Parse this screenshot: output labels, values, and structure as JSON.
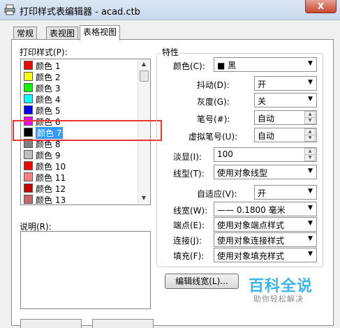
{
  "window": {
    "title": "打印样式表编辑器 - acad.ctb",
    "close": "X"
  },
  "tabs": [
    "常规",
    "表视图",
    "表格视图"
  ],
  "styles": {
    "label": "打印样式(P):",
    "items": [
      {
        "label": "颜色 1",
        "color": "#ff0000"
      },
      {
        "label": "颜色 2",
        "color": "#ffff00"
      },
      {
        "label": "颜色 3",
        "color": "#00ff00"
      },
      {
        "label": "颜色 4",
        "color": "#00ffff"
      },
      {
        "label": "颜色 5",
        "color": "#0000ff"
      },
      {
        "label": "颜色 6",
        "color": "#ff00ff"
      },
      {
        "label": "颜色 7",
        "color": "#000000"
      },
      {
        "label": "颜色 8",
        "color": "#808080"
      },
      {
        "label": "颜色 9",
        "color": "#c0c0c0"
      },
      {
        "label": "颜色 10",
        "color": "#ff0000"
      },
      {
        "label": "颜色 11",
        "color": "#ff7f7f"
      },
      {
        "label": "颜色 12",
        "color": "#cc0000"
      },
      {
        "label": "颜色 13",
        "color": "#cc6666"
      }
    ],
    "selected_index": 6
  },
  "description": {
    "label": "说明(R):"
  },
  "properties": {
    "group_title": "特性",
    "color": {
      "label": "颜色(C):",
      "value": "■ 黑"
    },
    "dither": {
      "label": "抖动(D):",
      "value": "开"
    },
    "grayscale": {
      "label": "灰度(G):",
      "value": "关"
    },
    "pen": {
      "label": "笔号(#):",
      "value": "自动"
    },
    "virtual_pen": {
      "label": "虚拟笔号(U):",
      "value": "自动"
    },
    "screening": {
      "label": "淡显(I):",
      "value": "100"
    },
    "linetype": {
      "label": "线型(T):",
      "value": "使用对象线型"
    },
    "adaptive": {
      "label": "自适应(V):",
      "value": "开"
    },
    "lineweight": {
      "label": "线宽(W):",
      "value": "—— 0.1800 毫米"
    },
    "endstyle": {
      "label": "端点(E):",
      "value": "使用对象端点样式"
    },
    "joinstyle": {
      "label": "连接(J):",
      "value": "使用对象连接样式"
    },
    "fillstyle": {
      "label": "填充(F):",
      "value": "使用对象填充样式"
    },
    "edit_lineweights": "编辑线宽(L)..."
  },
  "watermark": {
    "main": "百科全说",
    "sub": "助你轻松解决"
  }
}
